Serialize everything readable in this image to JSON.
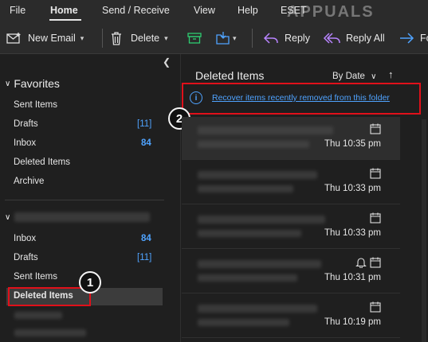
{
  "ribbon": {
    "tabs": [
      "File",
      "Home",
      "Send / Receive",
      "View",
      "Help",
      "ESET"
    ],
    "active_tab": "Home",
    "toolbar": {
      "new_email": "New Email",
      "delete": "Delete",
      "reply": "Reply",
      "reply_all": "Reply All",
      "forward": "Fo"
    }
  },
  "watermark": "APPUALS",
  "favorites": {
    "header": "Favorites",
    "items": [
      {
        "label": "Sent Items",
        "count": ""
      },
      {
        "label": "Drafts",
        "count": "[11]"
      },
      {
        "label": "Inbox",
        "count": "84"
      },
      {
        "label": "Deleted Items",
        "count": ""
      },
      {
        "label": "Archive",
        "count": ""
      }
    ]
  },
  "account": {
    "items": [
      {
        "label": "Inbox",
        "count": "84"
      },
      {
        "label": "Drafts",
        "count": "[11]"
      },
      {
        "label": "Sent Items",
        "count": ""
      },
      {
        "label": "Deleted Items",
        "count": ""
      }
    ]
  },
  "message_list": {
    "title": "Deleted Items",
    "sort_label": "By Date",
    "sort_direction": "↑",
    "recover_link": "Recover items recently removed from this folder",
    "messages": [
      {
        "time": "Thu 10:35 pm",
        "icons": [
          "calendar-icon"
        ]
      },
      {
        "time": "Thu 10:33 pm",
        "icons": [
          "calendar-icon"
        ]
      },
      {
        "time": "Thu 10:33 pm",
        "icons": [
          "calendar-icon"
        ]
      },
      {
        "time": "Thu 10:31 pm",
        "icons": [
          "bell-icon",
          "calendar-icon"
        ]
      },
      {
        "time": "Thu 10:19 pm",
        "icons": [
          "calendar-icon"
        ]
      }
    ]
  },
  "annotations": {
    "badge1": "1",
    "badge2": "2"
  },
  "colors": {
    "accent": "#4fa3ff",
    "highlight_red": "#e0101a",
    "background": "#1f1f1f"
  }
}
